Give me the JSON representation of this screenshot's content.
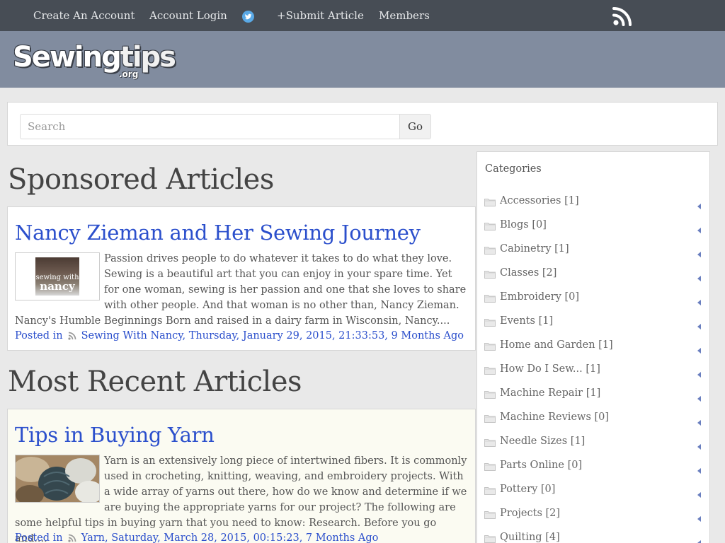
{
  "nav": {
    "links": [
      "Create An Account",
      "Account Login",
      "+Submit Article",
      "Members"
    ],
    "icons": {
      "twitter": "twitter-icon",
      "rss": "rss-icon"
    }
  },
  "logo": {
    "main_a": "Sewing",
    "main_b": "tips",
    "suffix": ".org"
  },
  "search": {
    "placeholder": "Search",
    "button": "Go"
  },
  "sponsored": {
    "heading": "Sponsored Articles",
    "article": {
      "title": "Nancy Zieman and Her Sewing Journey",
      "thumb_text_1": "sewing with",
      "thumb_text_2": "nancy",
      "excerpt": "Passion drives people to do whatever it takes to do what they love. Sewing is a beautiful art that you can enjoy in your spare time. Yet for one woman, sewing is her passion and one that she loves to share with other people. And that woman is no other than, Nancy Zieman.   Nancy's Humble Beginnings Born and raised in a dairy farm in Wisconsin, Nancy....",
      "posted_in": "Posted in",
      "meta": "Sewing With Nancy, Thursday, January 29, 2015, 21:33:53, 9 Months Ago"
    }
  },
  "recent": {
    "heading": "Most Recent Articles",
    "article": {
      "title": "Tips in Buying Yarn",
      "excerpt": "Yarn is an extensively long piece of intertwined fibers.  It is commonly used in crocheting, knitting, weaving, and embroidery projects. With a wide array of yarns out there, how do we know and determine if we are buying the appropriate yarns for our project? The following are some helpful tips in buying yarn that you need to know: Research. Before you go and....",
      "posted_in": "Posted in",
      "meta": "Yarn, Saturday, March 28, 2015, 00:15:23, 7 Months Ago"
    }
  },
  "sidebar": {
    "title": "Categories",
    "categories": [
      "Accessories [1]",
      "Blogs [0]",
      "Cabinetry [1]",
      "Classes [2]",
      "Embroidery [0]",
      "Events [1]",
      "Home and Garden [1]",
      "How Do I Sew... [1]",
      "Machine Repair [1]",
      "Machine Reviews [0]",
      "Needle Sizes [1]",
      "Parts Online [0]",
      "Pottery [0]",
      "Projects [2]",
      "Quilting [4]"
    ]
  }
}
